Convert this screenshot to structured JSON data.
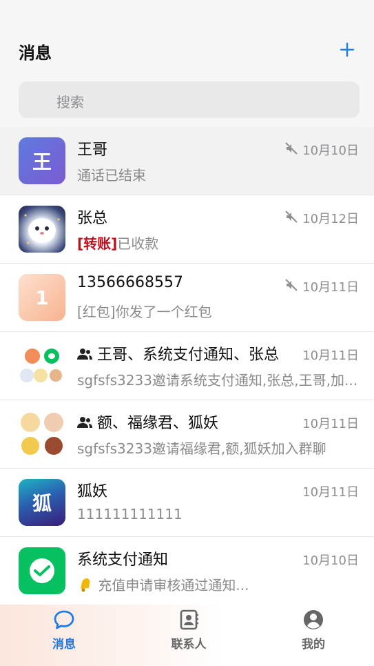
{
  "header": {
    "title": "消息",
    "plus_icon": "plus-icon",
    "accent": "#1e7ce8"
  },
  "search": {
    "placeholder": "搜索"
  },
  "conversations": [
    {
      "name": "王哥",
      "avatar_text": "王",
      "avatar_color": "#6b5fd4",
      "subtitle": "通话已结束",
      "date": "10月10日",
      "muted": true
    },
    {
      "name": "张总",
      "avatar_text": "",
      "subtitle_tag": "[转账]",
      "subtitle": "已收款",
      "date": "10月12日",
      "muted": true
    },
    {
      "name": "13566668557",
      "avatar_text": "1",
      "avatar_color": "#f9b996",
      "subtitle": "[红包]你发了一个红包",
      "date": "10月11日",
      "muted": true
    },
    {
      "name": "王哥、系统支付通知、张总",
      "group": true,
      "subtitle": "sgfsfs3233邀请系统支付通知,张总,王哥,加...",
      "date": "10月11日",
      "muted": false
    },
    {
      "name": "额、福缘君、狐妖",
      "group": true,
      "subtitle": "sgfsfs3233邀请福缘君,额,狐妖加入群聊",
      "date": "10月11日",
      "muted": false
    },
    {
      "name": "狐妖",
      "avatar_text": "狐",
      "avatar_color": "#2a3b8f",
      "subtitle": "111111111111",
      "date": "10月11日",
      "muted": false
    },
    {
      "name": "系统支付通知",
      "avatar_text": "",
      "avatar_color": "#07c160",
      "subtitle": "充值申请审核通过通知...",
      "date": "10月10日",
      "muted": false
    }
  ],
  "tabs": [
    {
      "label": "消息",
      "icon": "chat-bubble-icon",
      "active": true
    },
    {
      "label": "联系人",
      "icon": "contacts-icon",
      "active": false
    },
    {
      "label": "我的",
      "icon": "profile-icon",
      "active": false
    }
  ]
}
